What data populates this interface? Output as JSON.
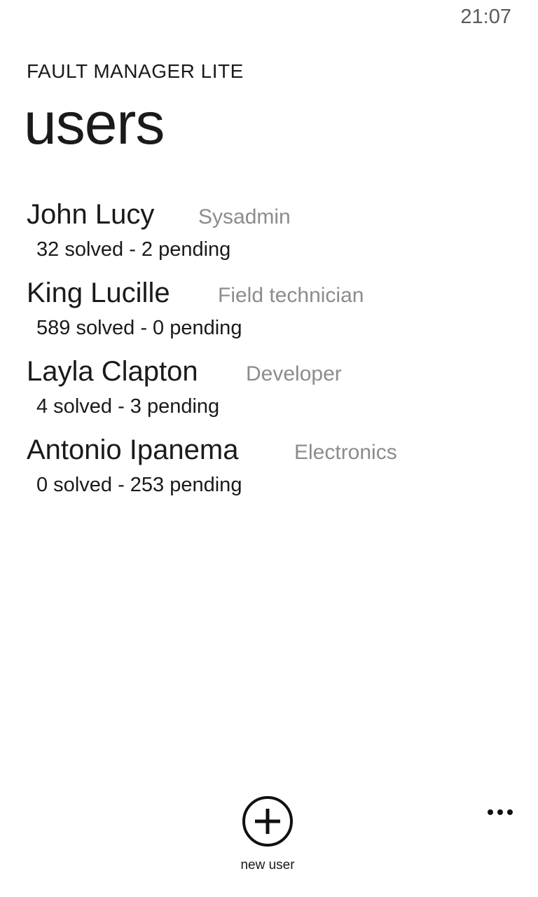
{
  "status_bar": {
    "time": "21:07"
  },
  "header": {
    "app_title": "FAULT MANAGER LITE",
    "page_title": "users"
  },
  "users": [
    {
      "name": "John Lucy",
      "role": "Sysadmin",
      "stats": "32 solved - 2 pending"
    },
    {
      "name": "King Lucille",
      "role": "Field technician",
      "stats": "589 solved - 0 pending"
    },
    {
      "name": "Layla Clapton",
      "role": "Developer",
      "stats": "4 solved - 3 pending"
    },
    {
      "name": "Antonio Ipanema",
      "role": "Electronics",
      "stats": "0 solved - 253 pending"
    }
  ],
  "app_bar": {
    "new_user_label": "new user",
    "new_user_icon": "plus-circle-icon",
    "more_icon": "ellipsis-icon"
  }
}
